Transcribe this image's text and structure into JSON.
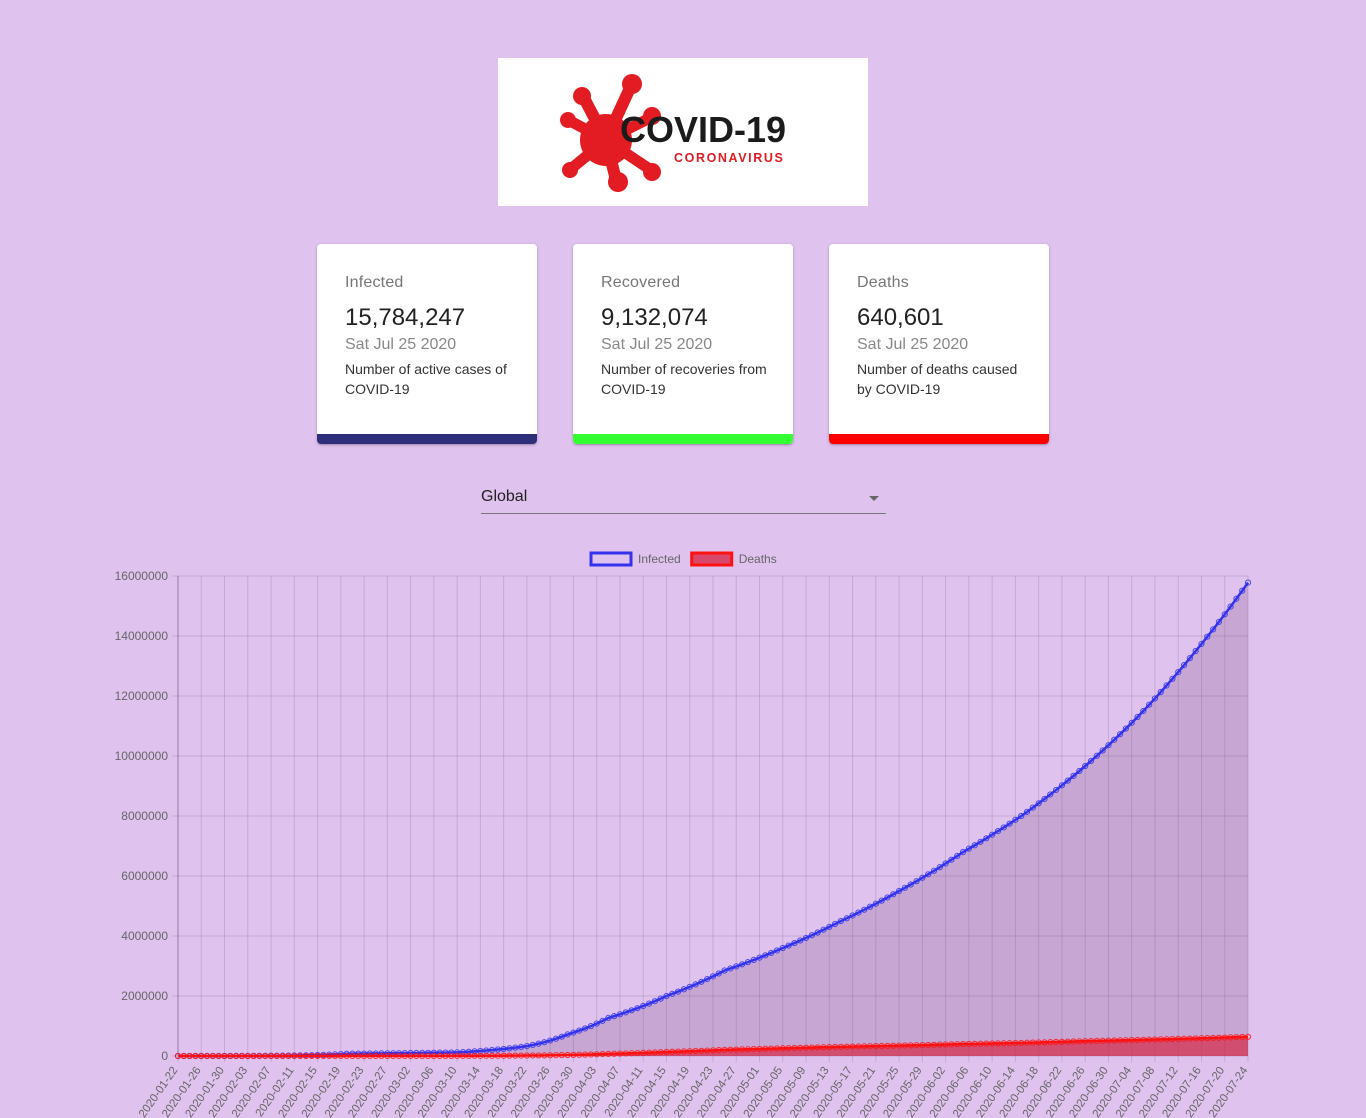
{
  "logo": {
    "title": "COVID-19",
    "subtitle": "CORONAVIRUS"
  },
  "cards": [
    {
      "title": "Infected",
      "value": "15,784,247",
      "date": "Sat Jul 25 2020",
      "desc": "Number of active cases of COVID-19",
      "color": "#2e2e7a"
    },
    {
      "title": "Recovered",
      "value": "9,132,074",
      "date": "Sat Jul 25 2020",
      "desc": "Number of recoveries from COVID-19",
      "color": "#33ff33"
    },
    {
      "title": "Deaths",
      "value": "640,601",
      "date": "Sat Jul 25 2020",
      "desc": "Number of deaths caused by COVID-19",
      "color": "#ff0000"
    }
  ],
  "country_select": {
    "value": "Global"
  },
  "chart_data": {
    "type": "area",
    "x_start": "2020-01-22",
    "x_end": "2020-07-24",
    "x_tick_every_days": 4,
    "ylim": [
      0,
      16000000
    ],
    "yticks": [
      0,
      2000000,
      4000000,
      6000000,
      8000000,
      10000000,
      12000000,
      14000000,
      16000000
    ],
    "legend": "top-center",
    "grid": true,
    "series": [
      {
        "name": "Infected",
        "color": "#3333ee",
        "anchors": [
          [
            "2020-01-22",
            555
          ],
          [
            "2020-02-20",
            76000
          ],
          [
            "2020-03-10",
            120000
          ],
          [
            "2020-03-22",
            330000
          ],
          [
            "2020-03-29",
            720000
          ],
          [
            "2020-04-05",
            1270000
          ],
          [
            "2020-04-15",
            2000000
          ],
          [
            "2020-04-25",
            2850000
          ],
          [
            "2020-05-05",
            3600000
          ],
          [
            "2020-05-15",
            4500000
          ],
          [
            "2020-05-25",
            5500000
          ],
          [
            "2020-06-05",
            6800000
          ],
          [
            "2020-06-15",
            8000000
          ],
          [
            "2020-06-25",
            9500000
          ],
          [
            "2020-07-05",
            11300000
          ],
          [
            "2020-07-15",
            13500000
          ],
          [
            "2020-07-24",
            15780000
          ]
        ]
      },
      {
        "name": "Deaths",
        "color": "#ff1111",
        "anchors": [
          [
            "2020-01-22",
            17
          ],
          [
            "2020-02-20",
            2250
          ],
          [
            "2020-03-10",
            4260
          ],
          [
            "2020-03-22",
            14600
          ],
          [
            "2020-03-29",
            33000
          ],
          [
            "2020-04-05",
            70000
          ],
          [
            "2020-04-15",
            135000
          ],
          [
            "2020-04-25",
            205000
          ],
          [
            "2020-05-05",
            258000
          ],
          [
            "2020-05-15",
            306000
          ],
          [
            "2020-05-25",
            346000
          ],
          [
            "2020-06-05",
            398000
          ],
          [
            "2020-06-15",
            436000
          ],
          [
            "2020-06-25",
            490000
          ],
          [
            "2020-07-05",
            535000
          ],
          [
            "2020-07-15",
            585000
          ],
          [
            "2020-07-24",
            640000
          ]
        ]
      }
    ]
  }
}
